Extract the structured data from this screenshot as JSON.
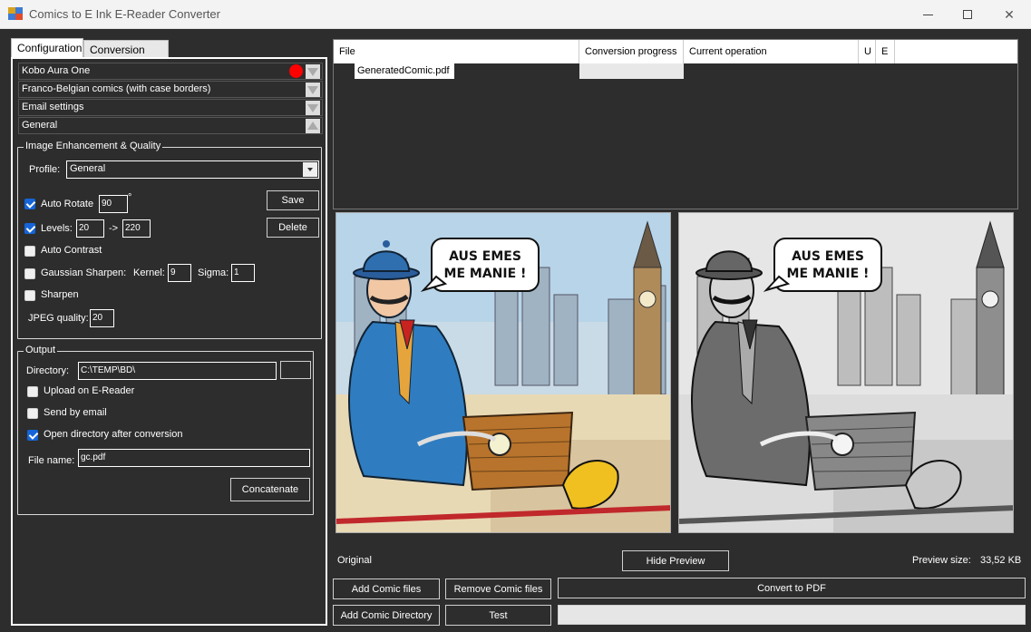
{
  "window": {
    "title": "Comics to  E Ink E-Reader Converter"
  },
  "tabs": {
    "configuration": "Configuration",
    "conversion_errors": "Conversion errors"
  },
  "combos": [
    {
      "label": "Kobo Aura One",
      "has_status_dot": true,
      "status_color": "#ff0000",
      "expanded": false
    },
    {
      "label": "Franco-Belgian comics (with case borders)",
      "expanded": false
    },
    {
      "label": "Email settings",
      "expanded": false
    },
    {
      "label": "General",
      "expanded": true
    }
  ],
  "image_enhancement": {
    "legend": "Image Enhancement & Quality",
    "profile_label": "Profile:",
    "profile_value": "General",
    "auto_rotate": {
      "label": "Auto Rotate",
      "checked": true,
      "value": "90",
      "unit": "°"
    },
    "levels": {
      "label": "Levels:",
      "checked": true,
      "from": "20",
      "arrow": "->",
      "to": "220"
    },
    "auto_contrast": {
      "label": "Auto Contrast",
      "checked": false
    },
    "gaussian_sharpen": {
      "label": "Gaussian Sharpen:",
      "checked": false,
      "kernel_label": "Kernel:",
      "kernel": "9",
      "sigma_label": "Sigma:",
      "sigma": "1"
    },
    "sharpen": {
      "label": "Sharpen",
      "checked": false
    },
    "jpeg_quality": {
      "label": "JPEG quality:",
      "value": "20"
    },
    "save_button": "Save",
    "delete_button": "Delete"
  },
  "output": {
    "legend": "Output",
    "directory_label": "Directory:",
    "directory_value": "C:\\TEMP\\BD\\",
    "upload": {
      "label": "Upload on E-Reader",
      "checked": false
    },
    "send_email": {
      "label": "Send by email",
      "checked": false
    },
    "open_dir": {
      "label": "Open directory after conversion",
      "checked": true
    },
    "file_name_label": "File name:",
    "file_name_value": "gc.pdf",
    "concatenate_button": "Concatenate"
  },
  "file_grid": {
    "columns": [
      "File",
      "Conversion progress",
      "Current operation",
      "U",
      "E"
    ],
    "rows": [
      {
        "file": "GeneratedComic.pdf",
        "progress": "",
        "operation": ""
      }
    ]
  },
  "preview": {
    "original_label": "Original",
    "hide_preview_button": "Hide Preview",
    "size_label": "Preview size:",
    "size_value": "33,52 KB",
    "speech_bubble": [
      "AUS EMES",
      "ME MANIE !"
    ]
  },
  "actions": {
    "add_files": "Add Comic files",
    "remove_files": "Remove Comic files",
    "convert": "Convert to PDF",
    "add_directory": "Add Comic Directory",
    "test": "Test"
  }
}
